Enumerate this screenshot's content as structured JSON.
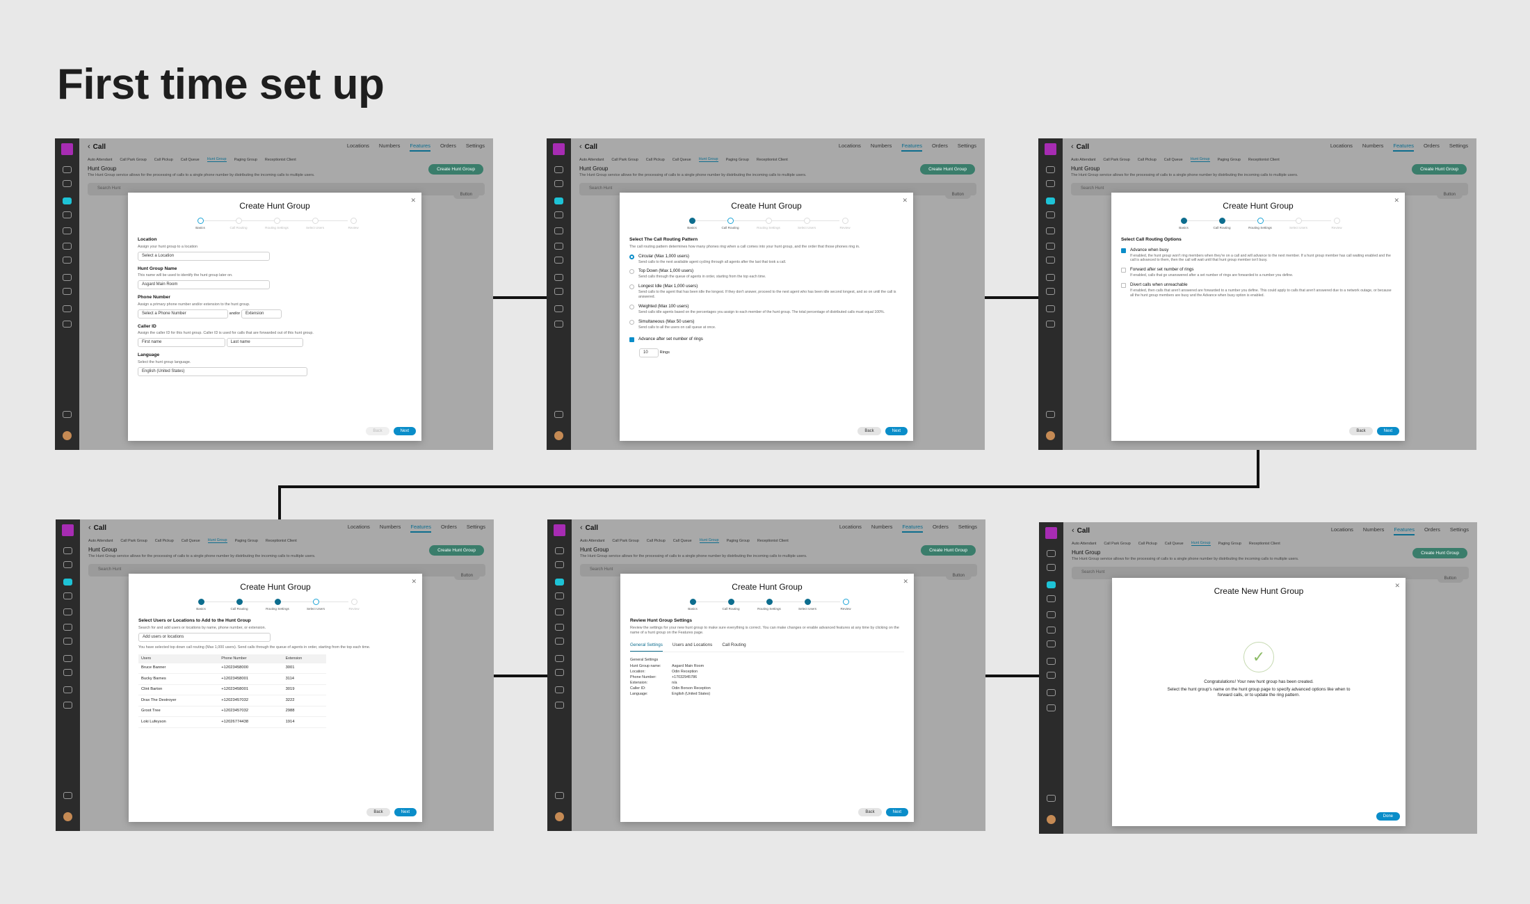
{
  "page": {
    "title": "First time set up"
  },
  "app": {
    "back": "‹",
    "title": "Call",
    "nav": [
      "Locations",
      "Numbers",
      "Features",
      "Orders",
      "Settings"
    ],
    "nav_active": "Features",
    "subnav": [
      "Auto Attendant",
      "Call Park Group",
      "Call Pickup",
      "Call Queue",
      "Hunt Group",
      "Paging Group",
      "Receptionist Client"
    ],
    "subnav_active": "Hunt Group",
    "section_title": "Hunt Group",
    "section_desc": "The Hunt Group service allows for the processing of calls to a single phone number by distributing the incoming calls to multiple users.",
    "cta": "Create Hunt Group",
    "search_placeholder": "Search Hunt",
    "button": "Button"
  },
  "steps": [
    "Basics",
    "Call Routing",
    "Routing Settings",
    "Select Users",
    "Review"
  ],
  "buttons": {
    "back": "Back",
    "next": "Next",
    "done": "Done"
  },
  "modal_title": "Create Hunt Group",
  "s1": {
    "location": "Location",
    "location_hint": "Assign your hunt group to a location",
    "location_select": "Select a Location",
    "name": "Hunt Group Name",
    "name_hint": "This name will be used to identify the hunt group later on.",
    "name_value": "Asgard Main Room",
    "phone": "Phone Number",
    "phone_hint": "Assign a primary phone number and/or extension to the hunt group.",
    "phone_ph": "Select a Phone Number",
    "andor": "and/or",
    "ext_ph": "Extension",
    "callerid": "Caller ID",
    "callerid_hint": "Assign the caller ID for this hunt group. Caller ID is used for calls that are forwarded out of this hunt group.",
    "first": "First name",
    "last": "Last name",
    "lang": "Language",
    "lang_hint": "Select the hunt group language.",
    "lang_value": "English (United States)"
  },
  "s2": {
    "heading": "Select The Call Routing Pattern",
    "hint": "The call routing pattern determines how many phones ring when a call comes into your hunt group, and the order that those phones ring in.",
    "options": [
      {
        "t": "Circular (Max 1,000 users)",
        "d": "Send calls to the next available agent cycling through all agents after the last that took a call."
      },
      {
        "t": "Top Down (Max 1,000 users)",
        "d": "Send calls through the queue of agents in order, starting from the top each time."
      },
      {
        "t": "Longest Idle (Max 1,000 users)",
        "d": "Send calls to the agent that has been idle the longest. If they don't answer, proceed to the next agent who has been idle second longest, and so on until the call is answered."
      },
      {
        "t": "Weighted (Max 100 users)",
        "d": "Send calls idle agents based on the percentages you assign to each member of the hunt group. The total percentage of distributed calls must equal 100%."
      },
      {
        "t": "Simultaneous (Max 50 users)",
        "d": "Send calls to all the users on call queue at once."
      }
    ],
    "advance": "Advance after set number of rings",
    "rings_value": "10",
    "rings": "Rings"
  },
  "s3": {
    "heading": "Select Call Routing Options",
    "options": [
      {
        "t": "Advance when busy",
        "d": "If enabled, the hunt group won't ring members when they're on a call and will advance to the next member. If a hunt group member has call waiting enabled and the call is advanced to them, then the call will wait until that hunt group member isn't busy."
      },
      {
        "t": "Forward after set number of rings",
        "d": "If enabled, calls that go unanswered after a set number of rings are forwarded to a number you define."
      },
      {
        "t": "Divert calls when unreachable",
        "d": "If enabled, then calls that aren't answered are forwarded to a number you define. This could apply to calls that aren't answered due to a network outage, or because all the hunt group members are busy and the Advance when busy option is enabled."
      }
    ]
  },
  "s4": {
    "heading": "Select Users or Locations to Add to the Hunt Group",
    "hint": "Search for and add users or locations by name, phone number, or extension.",
    "search_ph": "Add users or locations",
    "note": "You have selected top down call routing (Max 1,000 users). Send calls through the queue of agents in order, starting from the top each time.",
    "cols": [
      "Users",
      "Phone Number",
      "Extension"
    ],
    "rows": [
      [
        "Bruce Banner",
        "+12023458000",
        "3001"
      ],
      [
        "Bucky Barnes",
        "+12023458001",
        "3114"
      ],
      [
        "Clint Barton",
        "+12023458001",
        "3019"
      ],
      [
        "Drax The Destroyer",
        "+12023457032",
        "3222"
      ],
      [
        "Groot Tree",
        "+12023457032",
        "2988"
      ],
      [
        "Loki Lufeyson",
        "+12026774438",
        "1914"
      ]
    ]
  },
  "s5": {
    "heading": "Review Hunt Group Settings",
    "hint": "Review the settings for your new hunt group to make sure everything is correct. You can make changes or enable advanced features at any time by clicking on the name of a hunt group on the Features page.",
    "tabs": [
      "General Settings",
      "Users and Locations",
      "Call Routing"
    ],
    "general": "General Settings",
    "kv": [
      [
        "Hunt Group name:",
        "Asgard Main Room"
      ],
      [
        "Location:",
        "Odin Reception"
      ],
      [
        "Phone Number:",
        "+17032945786"
      ],
      [
        "Extension:",
        "n/a"
      ],
      [
        "Caller ID:",
        "Odin Borson Reception"
      ],
      [
        "Language:",
        "English (United States)"
      ]
    ]
  },
  "s6": {
    "title": "Create New Hunt Group",
    "msg1": "Congratulations! Your new hunt group has been created.",
    "msg2": "Select the hunt group's name on the hunt group page to specify advanced options like when to forward calls, or to update the ring pattern."
  }
}
